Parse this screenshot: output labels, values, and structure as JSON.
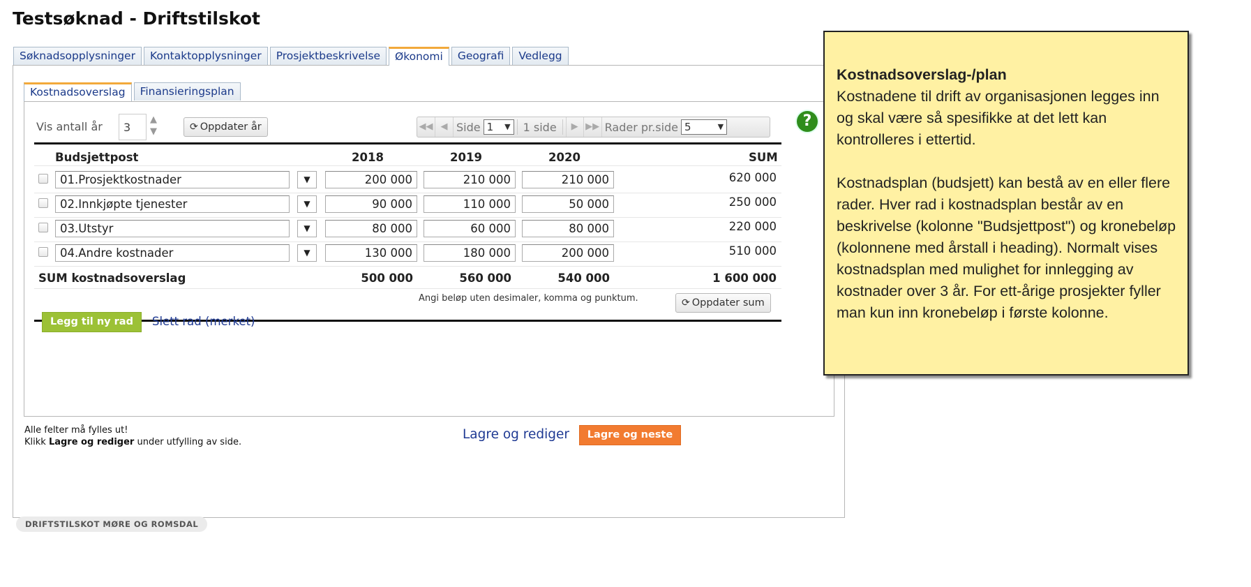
{
  "page": {
    "title": "Testsøknad - Driftstilskot"
  },
  "main_tabs": [
    {
      "label": "Søknadsopplysninger"
    },
    {
      "label": "Kontaktopplysninger"
    },
    {
      "label": "Prosjektbeskrivelse"
    },
    {
      "label": "Økonomi",
      "active": true
    },
    {
      "label": "Geografi"
    },
    {
      "label": "Vedlegg"
    }
  ],
  "inner_tabs": [
    {
      "label": "Kostnadsoverslag",
      "active": true
    },
    {
      "label": "Finansieringsplan"
    }
  ],
  "help": {
    "icon": "help-icon",
    "symbol": "?"
  },
  "years_control": {
    "label": "Vis antall år",
    "value": "3",
    "update_button": "Oppdater år"
  },
  "pager": {
    "side_label": "Side",
    "side_value": "1",
    "page_count": "1 side",
    "rows_label": "Rader pr.side",
    "rows_value": "5"
  },
  "table": {
    "headers": {
      "item": "Budsjettpost",
      "y1": "2018",
      "y2": "2019",
      "y3": "2020",
      "sum": "SUM"
    },
    "rows": [
      {
        "item": "01.Prosjektkostnader",
        "y1": "200 000",
        "y2": "210 000",
        "y3": "210 000",
        "sum": "620 000"
      },
      {
        "item": "02.Innkjøpte tjenester",
        "y1": "90 000",
        "y2": "110 000",
        "y3": "50 000",
        "sum": "250 000"
      },
      {
        "item": "03.Utstyr",
        "y1": "80 000",
        "y2": "60 000",
        "y3": "80 000",
        "sum": "220 000"
      },
      {
        "item": "04.Andre kostnader",
        "y1": "130 000",
        "y2": "180 000",
        "y3": "200 000",
        "sum": "510 000"
      }
    ],
    "totals": {
      "label": "SUM kostnadsoverslag",
      "y1": "500 000",
      "y2": "560 000",
      "y3": "540 000",
      "sum": "1 600 000"
    },
    "hint": "Angi beløp uten desimaler, komma og punktum.",
    "update_sum_button": "Oppdater sum"
  },
  "actions": {
    "add_row": "Legg til ny rad",
    "delete_row": "Slett rad (merket)",
    "save_edit": "Lagre og rediger",
    "save_next": "Lagre og neste"
  },
  "footnote": {
    "line1": "Alle felter må fylles ut!",
    "line2_prefix": "Klikk ",
    "line2_bold": "Lagre og rediger",
    "line2_suffix": " under utfylling av side."
  },
  "footer": {
    "badge": "DRIFTSTILSKOT MØRE OG ROMSDAL"
  },
  "note": {
    "title": "Kostnadsoverslag-/plan",
    "para1": "Kostnadene til drift av organisasjonen legges inn og skal være så spesifikke at det lett kan kontrolleres i ettertid.",
    "para2": "Kostnadsplan (budsjett) kan bestå av en eller flere rader. Hver rad i kostnadsplan består av en beskrivelse (kolonne \"Budsjettpost\") og kronebeløp (kolonnene med årstall i heading). Normalt vises kostnadsplan med mulighet for innlegging av kostnader over 3 år. For ett-årige prosjekter fyller man kun inn kronebeløp i første kolonne."
  },
  "colors": {
    "add_button": "#9cc136",
    "save_next_button": "#f27b30",
    "active_tab_accent": "#f2a93b",
    "link": "#1f3a93",
    "note_bg": "#fff1a3"
  }
}
